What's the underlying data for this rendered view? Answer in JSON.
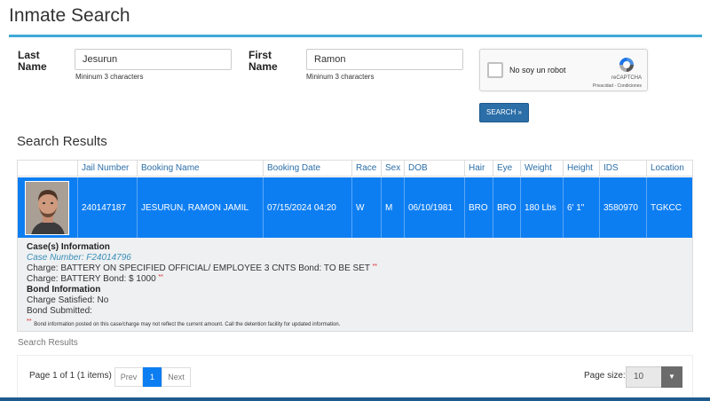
{
  "page": {
    "title": "Inmate Search"
  },
  "form": {
    "last_name_label": "Last Name",
    "last_name_value": "Jesurun",
    "last_name_hint": "Mininum 3 characters",
    "first_name_label": "First Name",
    "first_name_value": "Ramon",
    "first_name_hint": "Mininum 3 characters",
    "captcha_text": "No soy un robot",
    "captcha_brand": "reCAPTCHA",
    "captcha_links": "Privacidad - Condiciones",
    "search_button": "SEARCH »"
  },
  "results": {
    "title": "Search Results",
    "columns": [
      "Jail Number",
      "Booking Name",
      "Booking Date",
      "Race",
      "Sex",
      "DOB",
      "Hair",
      "Eye",
      "Weight",
      "Height",
      "IDS",
      "Location"
    ],
    "rows": [
      {
        "jail_number": "240147187",
        "booking_name": "JESURUN, RAMON JAMIL",
        "booking_date": "07/15/2024 04:20",
        "race": "W",
        "sex": "M",
        "dob": "06/10/1981",
        "hair": "BRO",
        "eye": "BRO",
        "weight": "180 Lbs",
        "height": "6' 1\"",
        "ids": "3580970",
        "location": "TGKCC"
      }
    ]
  },
  "detail": {
    "cases_heading": "Case(s) Information",
    "case_number": "Case Number: F24014796",
    "charge_1": "Charge: BATTERY ON SPECIFIED OFFICIAL/ EMPLOYEE 3 CNTS Bond: TO BE SET",
    "charge_2": "Charge: BATTERY Bond: $ 1000",
    "bond_heading": "Bond Information",
    "charge_satisfied": "Charge Satisfied: No",
    "bond_submitted": "Bond Submitted:",
    "star": "**",
    "note": "Bond information posted on this case/charge may not reflect the current amount. Call the detention facility for updated information."
  },
  "footer": {
    "label": "Search Results",
    "page_info": "Page 1 of 1 (1 items)",
    "prev": "Prev",
    "current_page": "1",
    "next": "Next",
    "page_size_label": "Page size:",
    "page_size_value": "10"
  },
  "colors": {
    "accent": "#3fa9d6",
    "row_highlight": "#0d7ef2",
    "button": "#2b6ea8"
  }
}
